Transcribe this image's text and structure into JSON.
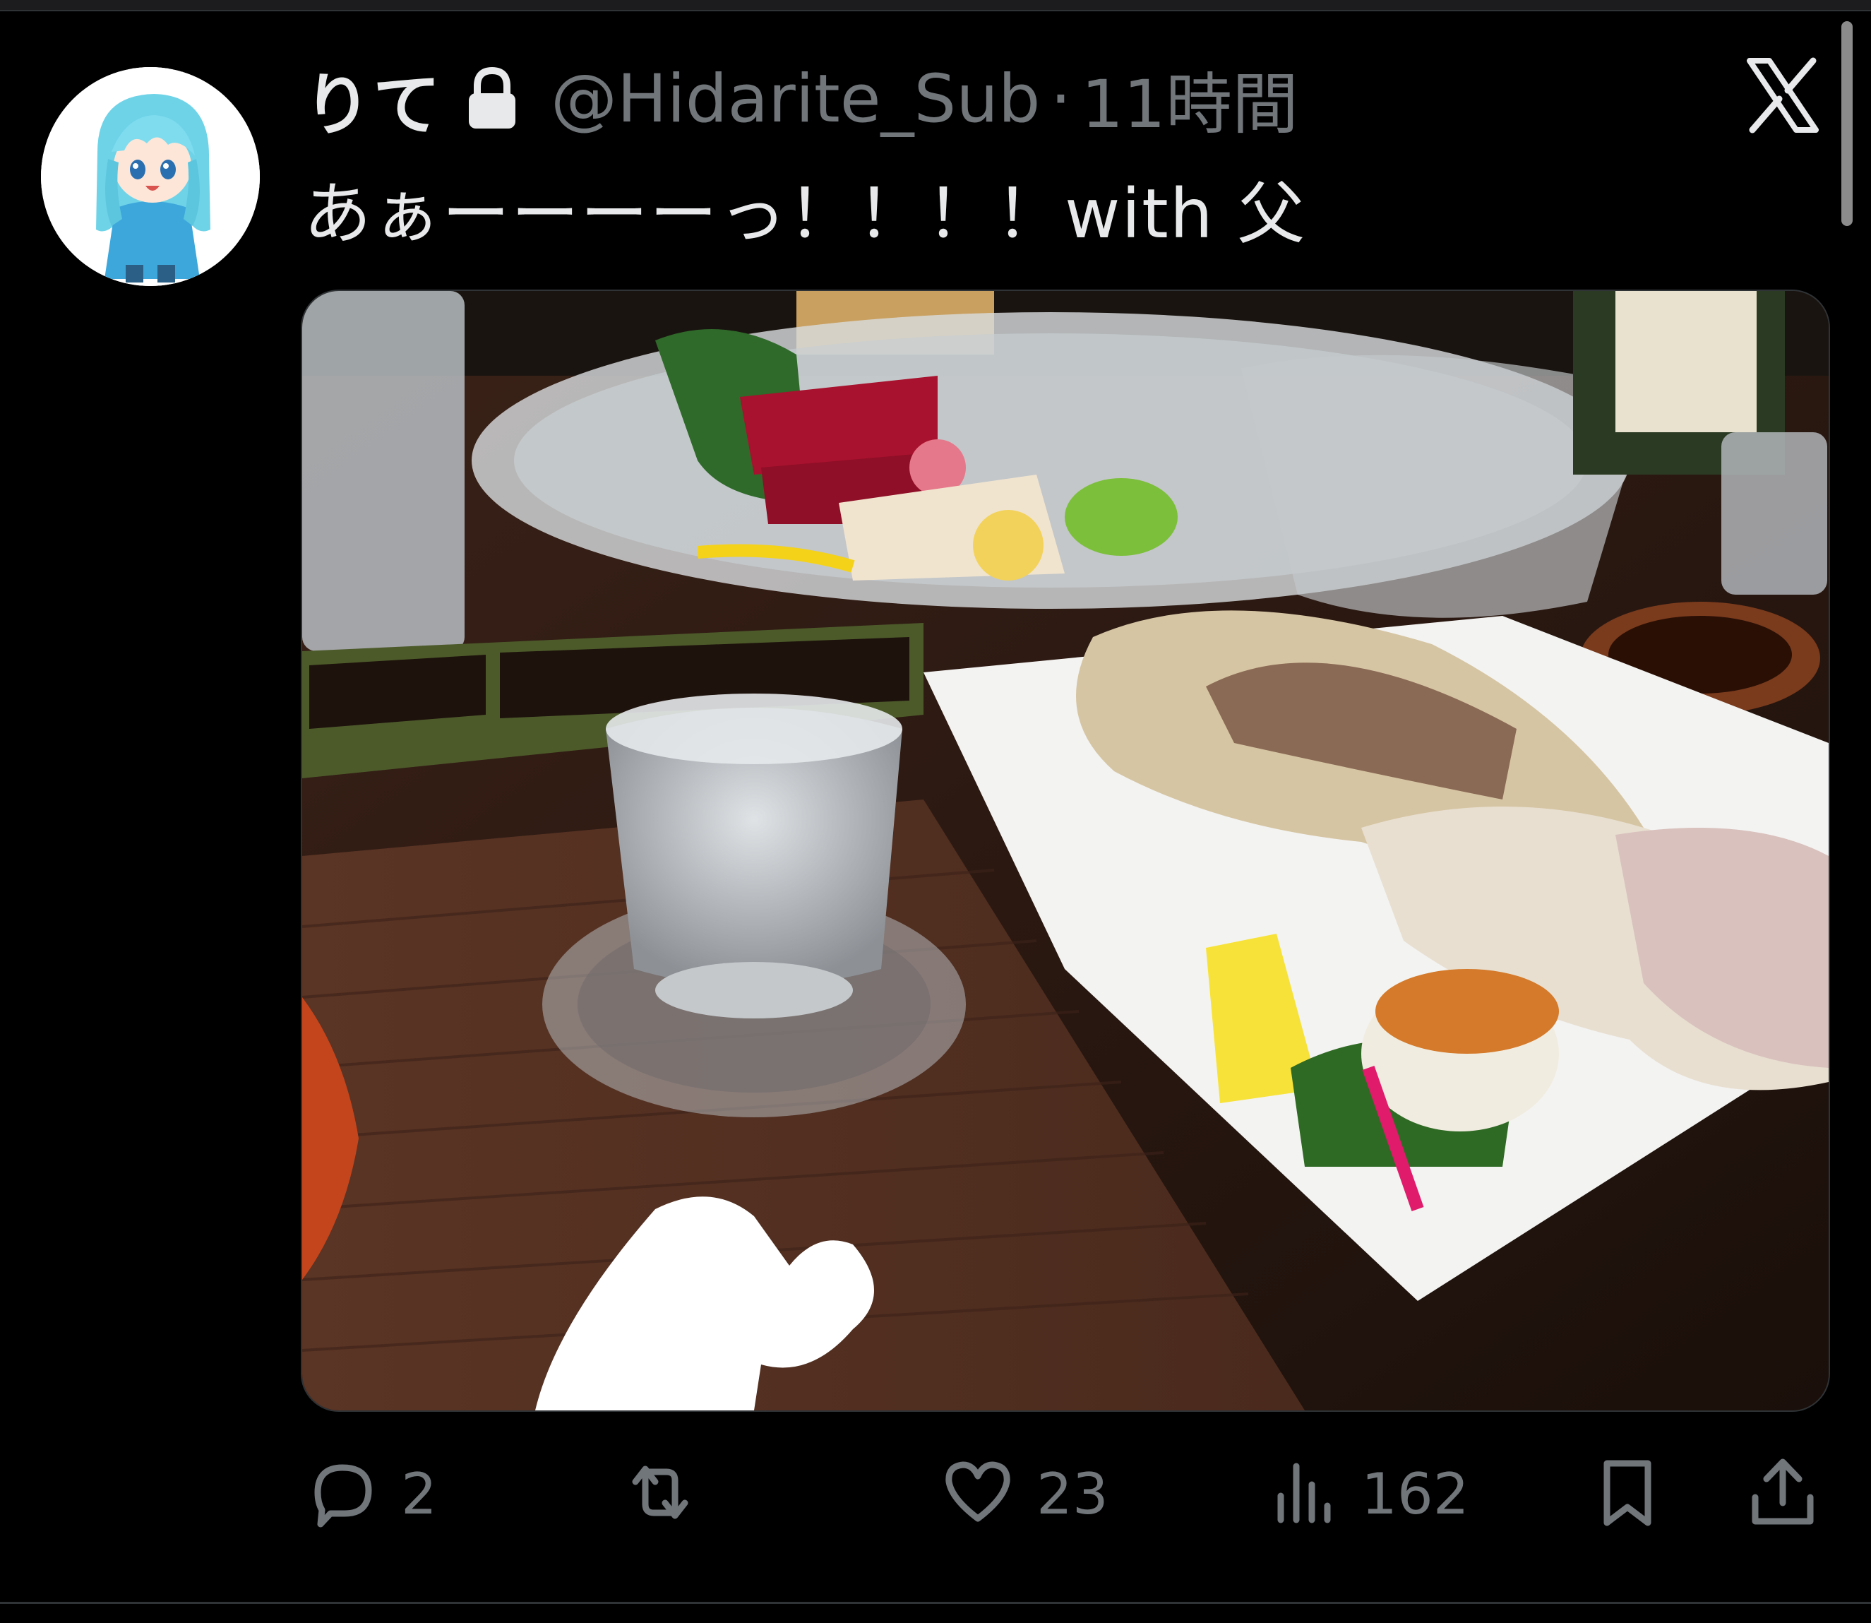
{
  "tweet": {
    "display_name": "りて",
    "protected_icon": "lock-icon",
    "handle": "@Hidarite_Sub",
    "separator": "·",
    "time": "11時間",
    "text": "あぁーーーーっ！！！！with 父",
    "platform_icon": "x-logo-icon",
    "media": {
      "alt": "",
      "description_icons": [
        "sake-glass",
        "sashimi-plate",
        "grilled-fish-head-plate"
      ]
    }
  },
  "actions": {
    "reply": {
      "icon": "reply-icon",
      "count": "2"
    },
    "retweet": {
      "icon": "retweet-icon",
      "count": ""
    },
    "like": {
      "icon": "heart-icon",
      "count": "23"
    },
    "views": {
      "icon": "views-icon",
      "count": "162"
    },
    "bookmark": {
      "icon": "bookmark-icon"
    },
    "share": {
      "icon": "share-icon"
    }
  },
  "colors": {
    "background": "#000000",
    "text_primary": "#e7e9ea",
    "text_secondary": "#71767b",
    "divider": "#2f3336"
  }
}
